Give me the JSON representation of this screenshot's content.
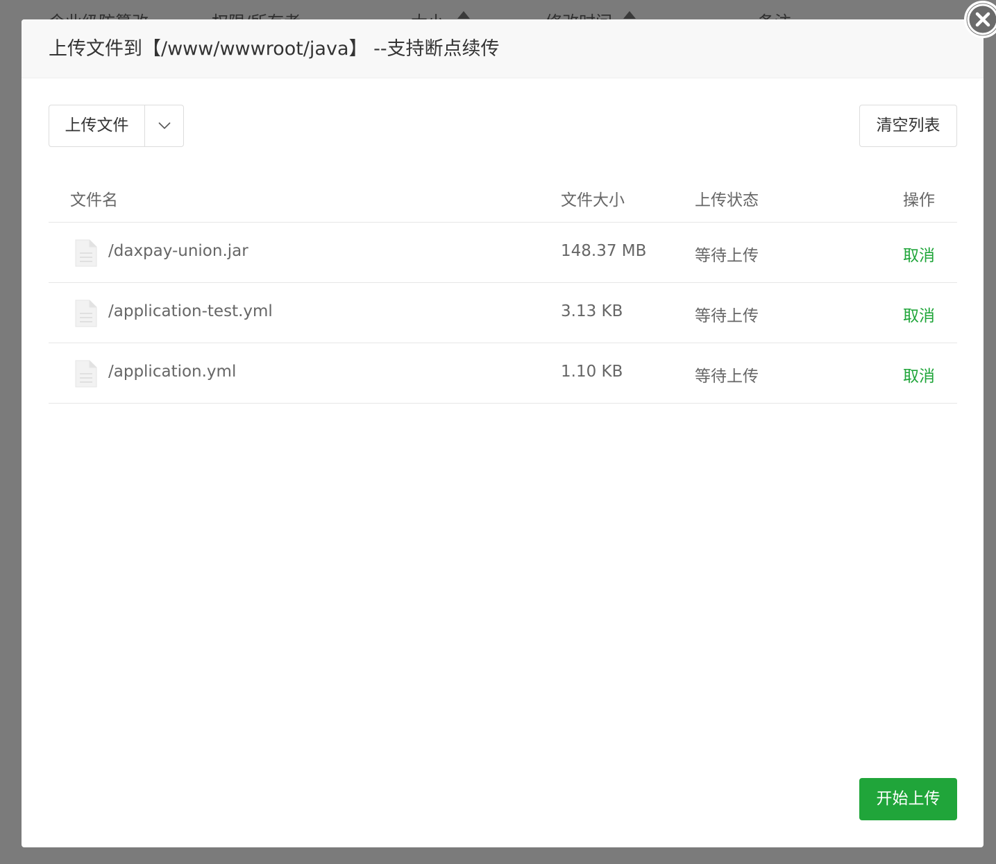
{
  "background": {
    "columns": [
      "企业级防篡改",
      "权限/所有者",
      "大小",
      "修改时间",
      "备注"
    ]
  },
  "dialog": {
    "title": "上传文件到【/www/wwwroot/java】 --支持断点续传",
    "upload_button": "上传文件",
    "clear_button": "清空列表",
    "start_button": "开始上传"
  },
  "table": {
    "headers": {
      "name": "文件名",
      "size": "文件大小",
      "status": "上传状态",
      "action": "操作"
    },
    "rows": [
      {
        "name": "/daxpay-union.jar",
        "size": "148.37 MB",
        "status": "等待上传",
        "action": "取消"
      },
      {
        "name": "/application-test.yml",
        "size": "3.13 KB",
        "status": "等待上传",
        "action": "取消"
      },
      {
        "name": "/application.yml",
        "size": "1.10 KB",
        "status": "等待上传",
        "action": "取消"
      }
    ]
  },
  "colors": {
    "accent": "#20a53a",
    "overlay": "#7b7b7b"
  },
  "icons": [
    "close-icon",
    "chevron-down-icon",
    "file-icon"
  ]
}
